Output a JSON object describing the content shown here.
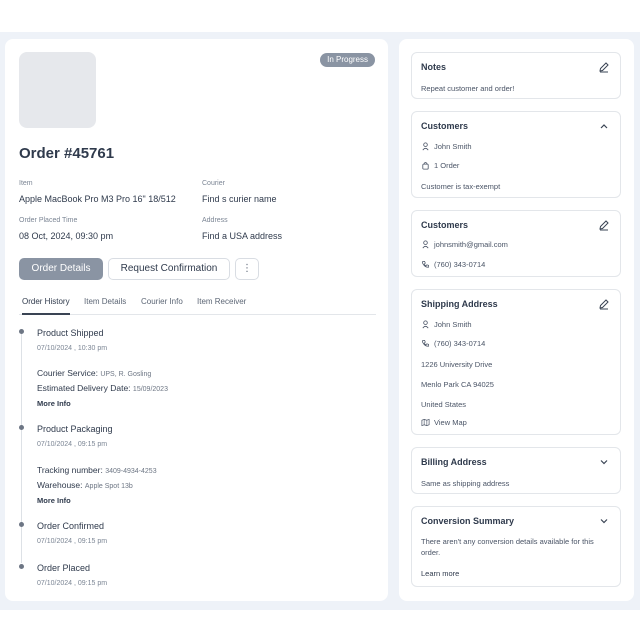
{
  "order": {
    "status": "In Progress",
    "title": "Order #45761",
    "item_label": "Item",
    "item_value": "Apple MacBook Pro M3 Pro 16\" 18/512",
    "courier_label": "Courier",
    "courier_value": "Find s curier name",
    "placed_label": "Order Placed Time",
    "placed_value": "08 Oct, 2024, 09:30 pm",
    "address_label": "Address",
    "address_value": "Find a USA address",
    "btn_details": "Order Details",
    "btn_confirm": "Request Confirmation",
    "btn_more": "⋮"
  },
  "tabs": [
    "Order History",
    "Item Details",
    "Courier Info",
    "Item Receiver"
  ],
  "timeline": [
    {
      "title": "Product Shipped",
      "time": "07/10/2024 , 10:30 pm",
      "detail1_label": "Courier Service:",
      "detail1_value": "UPS, R. Gosling",
      "detail2_label": "Estimated Delivery Date:",
      "detail2_value": "15/09/2023",
      "more": "More Info"
    },
    {
      "title": "Product Packaging",
      "time": "07/10/2024 , 09:15 pm",
      "detail1_label": "Tracking number:",
      "detail1_value": "3409-4934-4253",
      "detail2_label": "Warehouse:",
      "detail2_value": "Apple Spot 13b",
      "more": "More Info"
    },
    {
      "title": "Order Confirmed",
      "time": "07/10/2024 , 09:15 pm"
    },
    {
      "title": "Order Placed",
      "time": "07/10/2024 , 09:15 pm"
    }
  ],
  "notes": {
    "title": "Notes",
    "text": "Repeat customer and order!"
  },
  "customers": {
    "title": "Customers",
    "name": "John Smith",
    "orders": "1 Order",
    "tax": "Customer is tax-exempt"
  },
  "contact": {
    "title": "Customers",
    "email": "johnsmith@gmail.com",
    "phone": "(760) 343-0714"
  },
  "shipping": {
    "title": "Shipping Address",
    "name": "John Smith",
    "phone": "(760) 343-0714",
    "street": "1226 University Drive",
    "city": "Menlo Park CA 94025",
    "country": "United States",
    "map": "View Map"
  },
  "billing": {
    "title": "Billing Address",
    "text": "Same as shipping address"
  },
  "conversion": {
    "title": "Conversion Summary",
    "text": "There aren't any conversion details available for this order.",
    "link": "Learn more"
  },
  "colors": {
    "accent": "#8a94a3",
    "text": "#2f3a4c",
    "background": "#eef2f8"
  }
}
